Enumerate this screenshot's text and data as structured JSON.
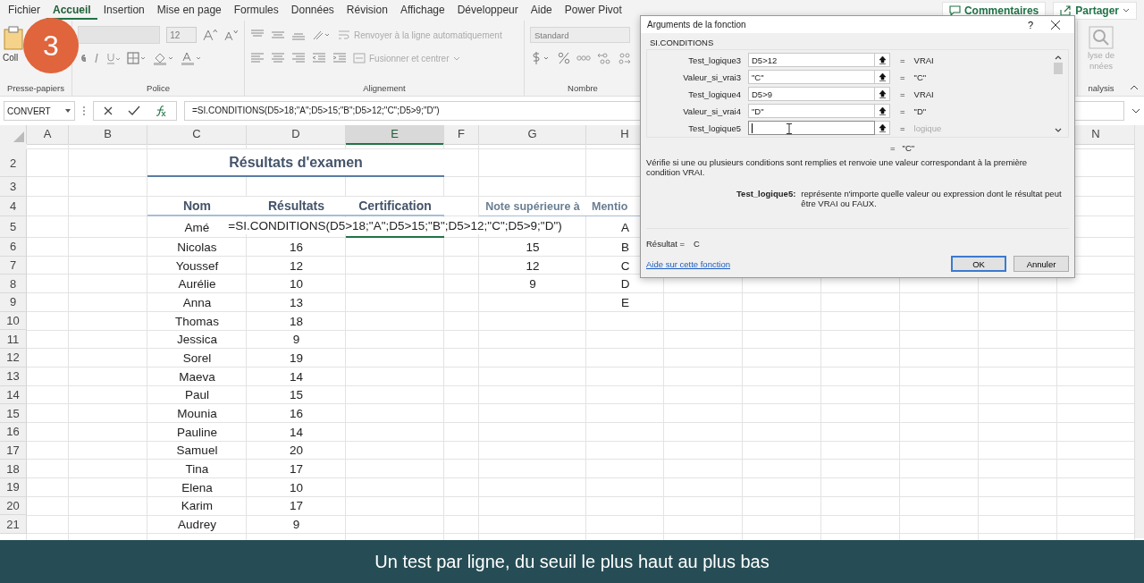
{
  "ribbon_tabs": [
    {
      "label": "Fichier",
      "selected": false
    },
    {
      "label": "Accueil",
      "selected": true
    },
    {
      "label": "Insertion",
      "selected": false
    },
    {
      "label": "Mise en page",
      "selected": false
    },
    {
      "label": "Formules",
      "selected": false
    },
    {
      "label": "Données",
      "selected": false
    },
    {
      "label": "Révision",
      "selected": false
    },
    {
      "label": "Affichage",
      "selected": false
    },
    {
      "label": "Développeur",
      "selected": false
    },
    {
      "label": "Aide",
      "selected": false
    },
    {
      "label": "Power Pivot",
      "selected": false
    }
  ],
  "share_buttons": [
    {
      "label": "Commentaires",
      "kind": "comment"
    },
    {
      "label": "Partager",
      "kind": "share"
    }
  ],
  "ribbon": {
    "clipboard": {
      "label": "Coll",
      "group": "Presse-papiers"
    },
    "font": {
      "size": "12",
      "disabled": true,
      "group": "Police"
    },
    "alignment": {
      "wrap": "Renvoyer à la ligne automatiquement",
      "merge": "Fusionner et centrer",
      "disabled": true,
      "group": "Alignement"
    },
    "number": {
      "format": "Standard",
      "disabled": true,
      "group": "Nombre"
    },
    "analysis": {
      "lines": [
        "lyse de",
        "nnées"
      ],
      "group": "nalysis"
    }
  },
  "formula_bar": {
    "name_box": "CONVERT",
    "formula": "=SI.CONDITIONS(D5>18;\"A\";D5>15;\"B\";D5>12;\"C\";D5>9;\"D\")"
  },
  "columns": [
    {
      "label": "A",
      "selected": false
    },
    {
      "label": "B",
      "selected": false
    },
    {
      "label": "C",
      "selected": false
    },
    {
      "label": "D",
      "selected": false
    },
    {
      "label": "E",
      "selected": true
    },
    {
      "label": "F",
      "selected": false
    },
    {
      "label": "G",
      "selected": false
    },
    {
      "label": "H",
      "selected": false
    },
    {
      "label": "N",
      "selected": false
    }
  ],
  "rows": [
    {
      "kind": "title",
      "number": "2",
      "text": "Résultats d'examen"
    },
    {
      "kind": "blank",
      "number": "3"
    },
    {
      "kind": "header",
      "number": "4",
      "name": "Nom",
      "result": "Résultats",
      "certification": "Certification",
      "threshold": "Note supérieure à",
      "mention": "Mentio"
    },
    {
      "kind": "data",
      "number": "5",
      "name": "Amé",
      "editing": "=SI.CONDITIONS(D5>18;\"A\";D5>15;\"B\";D5>12;\"C\";D5>9;\"D\")",
      "mention": "A"
    },
    {
      "kind": "data",
      "number": "6",
      "name": "Nicolas",
      "result": "16",
      "threshold": "15",
      "mention": "B"
    },
    {
      "kind": "data",
      "number": "7",
      "name": "Youssef",
      "result": "12",
      "threshold": "12",
      "mention": "C"
    },
    {
      "kind": "data",
      "number": "8",
      "name": "Aurélie",
      "result": "10",
      "threshold": "9",
      "mention": "D"
    },
    {
      "kind": "data",
      "number": "9",
      "name": "Anna",
      "result": "13",
      "mention": "E"
    },
    {
      "kind": "data",
      "number": "10",
      "name": "Thomas",
      "result": "18"
    },
    {
      "kind": "data",
      "number": "11",
      "name": "Jessica",
      "result": "9"
    },
    {
      "kind": "data",
      "number": "12",
      "name": "Sorel",
      "result": "19"
    },
    {
      "kind": "data",
      "number": "13",
      "name": "Maeva",
      "result": "14"
    },
    {
      "kind": "data",
      "number": "14",
      "name": "Paul",
      "result": "15"
    },
    {
      "kind": "data",
      "number": "15",
      "name": "Mounia",
      "result": "16"
    },
    {
      "kind": "data",
      "number": "16",
      "name": "Pauline",
      "result": "14"
    },
    {
      "kind": "data",
      "number": "17",
      "name": "Samuel",
      "result": "20"
    },
    {
      "kind": "data",
      "number": "18",
      "name": "Tina",
      "result": "17"
    },
    {
      "kind": "data",
      "number": "19",
      "name": "Elena",
      "result": "10"
    },
    {
      "kind": "data",
      "number": "20",
      "name": "Karim",
      "result": "17"
    },
    {
      "kind": "data",
      "number": "21",
      "name": "Audrey",
      "result": "9"
    }
  ],
  "dialog": {
    "title": "Arguments de la fonction",
    "help": "?",
    "function_name": "SI.CONDITIONS",
    "args": [
      {
        "label": "Test_logique3",
        "value": "D5>12",
        "sign": "=",
        "result": "VRAI",
        "muted": false,
        "focused": false
      },
      {
        "label": "Valeur_si_vrai3",
        "value": "\"C\"",
        "sign": "=",
        "result": "\"C\"",
        "muted": false,
        "focused": false
      },
      {
        "label": "Test_logique4",
        "value": "D5>9",
        "sign": "=",
        "result": "VRAI",
        "muted": false,
        "focused": false
      },
      {
        "label": "Valeur_si_vrai4",
        "value": "\"D\"",
        "sign": "=",
        "result": "\"D\"",
        "muted": false,
        "focused": false
      },
      {
        "label": "Test_logique5",
        "sign": "=",
        "result": "logique",
        "muted": true,
        "focused": true
      }
    ],
    "total_sign": "=",
    "total": "\"C\"",
    "description": "Vérifie si une ou plusieurs conditions sont remplies et renvoie une valeur correspondant à la première condition VRAI.",
    "arg_name": "Test_logique5:",
    "arg_help": "représente n'importe quelle valeur ou expression dont le résultat peut être VRAI ou FAUX.",
    "result_label": "Résultat =",
    "result_value": "C",
    "help_link": "Aide sur cette fonction",
    "buttons": [
      {
        "label": "OK",
        "default": true
      },
      {
        "label": "Annuler",
        "default": false
      }
    ]
  },
  "step_badge": "3",
  "caption": "Un test par ligne, du seuil le plus haut au plus bas"
}
